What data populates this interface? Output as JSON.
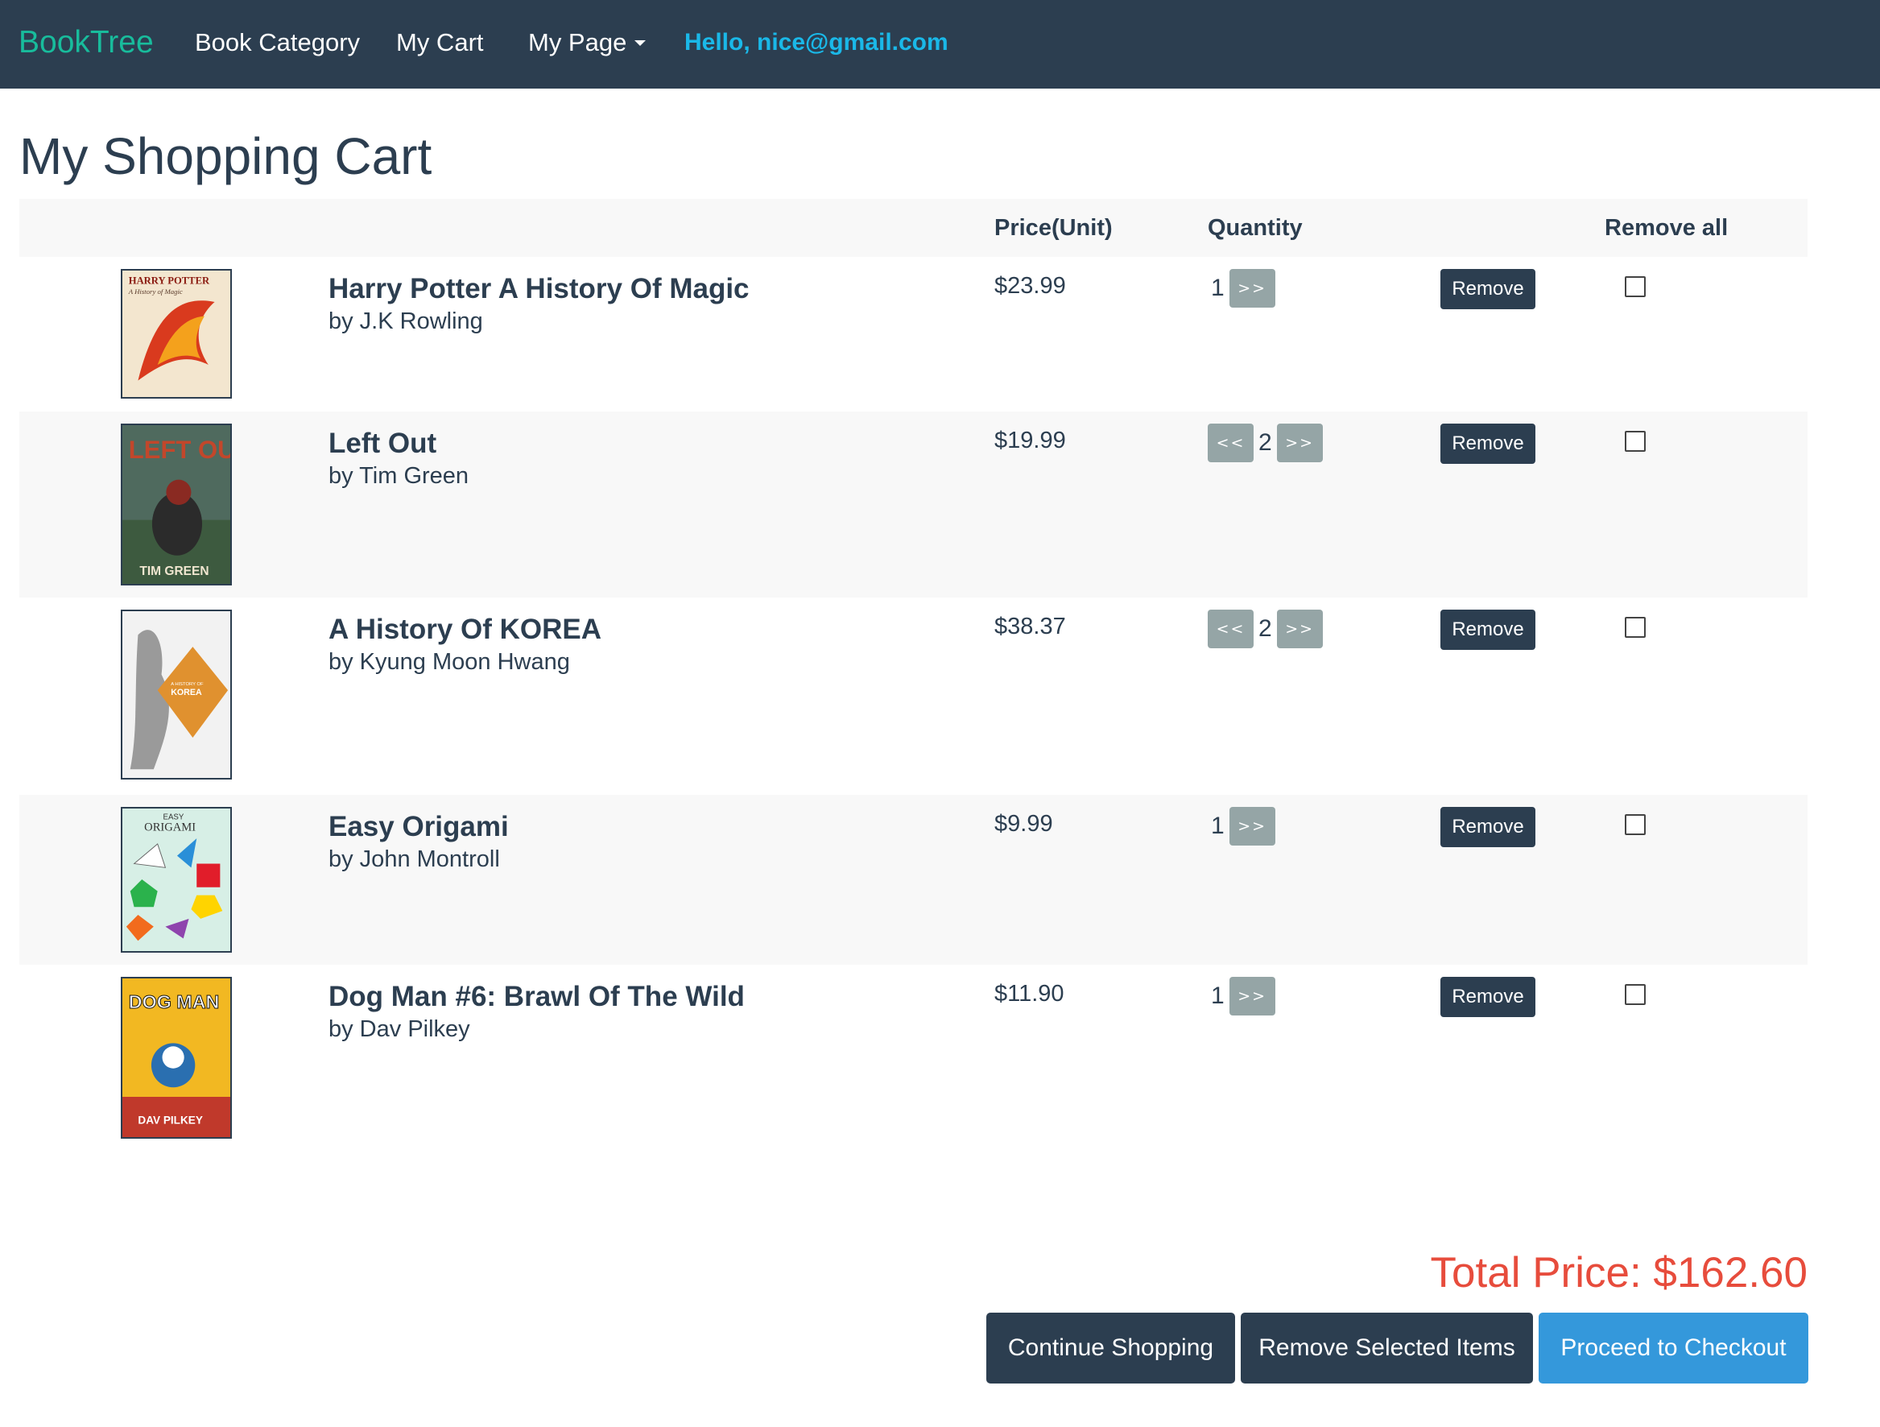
{
  "nav": {
    "brand": "BookTree",
    "category": "Book Category",
    "cart": "My Cart",
    "mypage": "My Page",
    "greeting": "Hello, nice@gmail.com"
  },
  "page_title": "My Shopping Cart",
  "table": {
    "headers": {
      "price": "Price(Unit)",
      "quantity": "Quantity",
      "remove_all": "Remove all"
    },
    "items": [
      {
        "title": "Harry Potter A History Of Magic",
        "author": "by J.K Rowling",
        "price": "$23.99",
        "quantity": "1",
        "cover_text": "HARRY POTTER",
        "cover_subtext": "A History of Magic",
        "cover_colors": [
          "#f3e6cf",
          "#d93a1e",
          "#f4a11c"
        ]
      },
      {
        "title": "Left Out",
        "author": "by Tim Green",
        "price": "$19.99",
        "quantity": "2",
        "cover_text": "LEFT OUT",
        "cover_subtext": "TIM GREEN",
        "cover_colors": [
          "#4f6a5e",
          "#c2472b",
          "#f0e6d0"
        ]
      },
      {
        "title": "A History Of KOREA",
        "author": "by Kyung Moon Hwang",
        "price": "$38.37",
        "quantity": "2",
        "cover_text": "KOREA",
        "cover_subtext": "A HISTORY OF",
        "cover_colors": [
          "#f2f2f2",
          "#e0912f",
          "#9a9a9a"
        ]
      },
      {
        "title": "Easy Origami",
        "author": "by John Montroll",
        "price": "$9.99",
        "quantity": "1",
        "cover_text": "ORIGAMI",
        "cover_subtext": "EASY",
        "cover_colors": [
          "#d7efe6",
          "#e11d2a",
          "#ffd400"
        ]
      },
      {
        "title": "Dog Man #6: Brawl Of The Wild",
        "author": "by Dav Pilkey",
        "price": "$11.90",
        "quantity": "1",
        "cover_text": "DOG MAN",
        "cover_subtext": "DAV PILKEY",
        "cover_colors": [
          "#f2b822",
          "#c0392b",
          "#2a6fb0"
        ]
      }
    ],
    "qty_decrement_label": "<<",
    "qty_increment_label": ">>",
    "remove_label": "Remove"
  },
  "total": "Total Price: $162.60",
  "buttons": {
    "continue": "Continue Shopping",
    "remove_selected": "Remove Selected Items",
    "checkout": "Proceed to Checkout"
  },
  "colors": {
    "navbar": "#2c3e50",
    "brand": "#18bc9c",
    "greeting": "#1ab8e8",
    "total": "#e74c3c",
    "checkout": "#3498db",
    "qty_button": "#95a5a6"
  }
}
